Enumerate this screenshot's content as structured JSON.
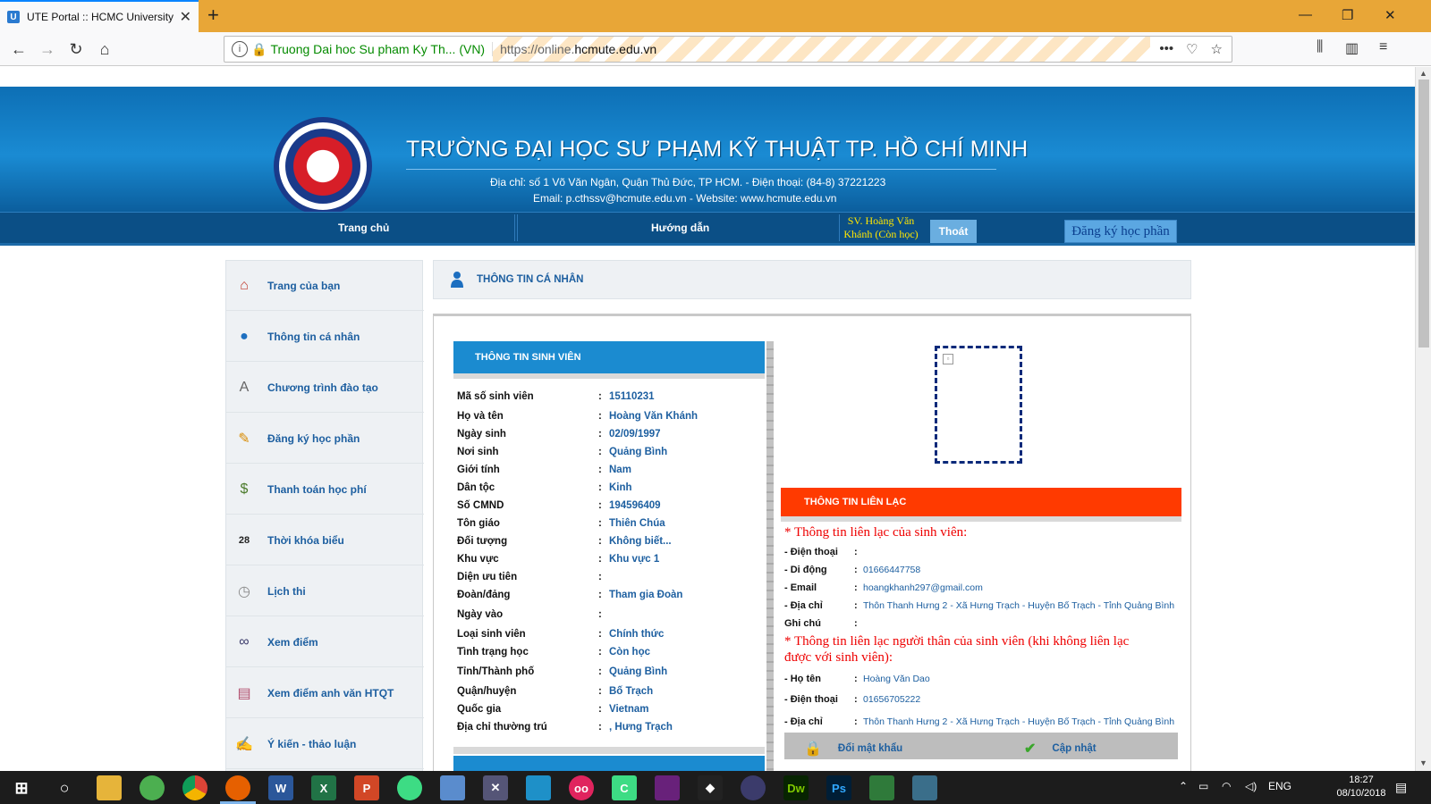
{
  "browser": {
    "tab_title": "UTE Portal :: HCMC University o",
    "identity": "Truong Dai hoc Su pham Ky Th... (VN)",
    "url_prefix": "https://online.",
    "url_domain": "hcmute.edu.vn"
  },
  "header": {
    "school_name": "TRƯỜNG ĐẠI HỌC SƯ PHẠM KỸ THUẬT TP. HỒ CHÍ MINH",
    "address": "Địa chỉ: số 1 Võ Văn Ngân, Quận Thủ Đức, TP HCM. - Điện thoại: (84-8) 37221223",
    "contact": "Email: p.cthssv@hcmute.edu.vn  - Website: www.hcmute.edu.vn"
  },
  "menu": {
    "home": "Trang chủ",
    "guide": "Hướng dẫn",
    "student": "SV. Hoàng Văn Khánh (Còn học)",
    "logout": "Thoát",
    "register": "Đăng ký học phần"
  },
  "sidebar": {
    "items": [
      {
        "label": "Trang của bạn",
        "icon": "house-icon"
      },
      {
        "label": "Thông tin cá nhân",
        "icon": "person-icon"
      },
      {
        "label": "Chương trình đào tạo",
        "icon": "book-icon"
      },
      {
        "label": "Đăng ký học phần",
        "icon": "pencil-icon"
      },
      {
        "label": "Thanh toán học phí",
        "icon": "payment-icon"
      },
      {
        "label": "Thời khóa biểu",
        "icon": "calendar-icon"
      },
      {
        "label": "Lịch thi",
        "icon": "clock-icon"
      },
      {
        "label": "Xem điểm",
        "icon": "binoculars-icon"
      },
      {
        "label": "Xem điểm anh văn HTQT",
        "icon": "clipboard-icon"
      },
      {
        "label": "Ý kiến - thảo luận",
        "icon": "feedback-icon"
      }
    ]
  },
  "main": {
    "title": "THÔNG TIN CÁ NHÂN",
    "student_section": "THÔNG TIN SINH VIÊN",
    "student_info": [
      {
        "label": "Mã số sinh viên",
        "value": "15110231"
      },
      {
        "label": "Họ và tên",
        "value": "Hoàng Văn Khánh"
      },
      {
        "label": "Ngày sinh",
        "value": "02/09/1997"
      },
      {
        "label": "Nơi sinh",
        "value": "Quảng Bình"
      },
      {
        "label": "Giới tính",
        "value": "Nam"
      },
      {
        "label": "Dân tộc",
        "value": "Kinh"
      },
      {
        "label": "Số CMND",
        "value": "194596409"
      },
      {
        "label": "Tôn giáo",
        "value": "Thiên Chúa"
      },
      {
        "label": "Đối tượng",
        "value": "Không biết..."
      },
      {
        "label": "Khu vực",
        "value": "Khu vực 1"
      },
      {
        "label": "Diện ưu tiên",
        "value": ""
      },
      {
        "label": "Đoàn/đảng",
        "value": "Tham gia Đoàn"
      },
      {
        "label": "Ngày vào",
        "value": ""
      },
      {
        "label": "Loại sinh viên",
        "value": "Chính thức"
      },
      {
        "label": "Tình trạng học",
        "value": "Còn học"
      },
      {
        "label": "Tỉnh/Thành phố",
        "value": "Quảng Bình"
      },
      {
        "label": "Quận/huyện",
        "value": "Bố Trạch"
      },
      {
        "label": "Quốc gia",
        "value": "Vietnam"
      },
      {
        "label": "Địa chỉ thường trú",
        "value": ", Hưng Trạch"
      }
    ],
    "contact_section": "THÔNG TIN LIÊN LẠC",
    "student_contact_heading": "* Thông tin liên lạc của sinh viên:",
    "student_contact": [
      {
        "label": "- Điện thoại",
        "value": ""
      },
      {
        "label": "- Di động",
        "value": "01666447758"
      },
      {
        "label": "- Email",
        "value": "hoangkhanh297@gmail.com"
      },
      {
        "label": "- Địa chỉ",
        "value": "Thôn Thanh Hưng 2 - Xã Hưng Trạch - Huyện Bố Trạch - Tỉnh Quảng Bình"
      },
      {
        "label": "Ghi chú",
        "value": ""
      }
    ],
    "relative_contact_heading_1": "* Thông tin liên lạc người thân của sinh viên (khi không liên lạc",
    "relative_contact_heading_2": "được với sinh viên):",
    "relative_contact": [
      {
        "label": "- Họ tên",
        "value": "Hoàng Văn Dao"
      },
      {
        "label": "- Điện thoại",
        "value": "01656705222"
      },
      {
        "label": "- Địa chỉ",
        "value": "Thôn Thanh Hưng 2 - Xã Hưng Trạch - Huyện Bố Trạch - Tỉnh Quảng Bình"
      }
    ],
    "change_password": "Đổi mật khẩu",
    "update": "Cập nhật"
  },
  "taskbar": {
    "language": "ENG",
    "time": "18:27",
    "date": "08/10/2018"
  }
}
